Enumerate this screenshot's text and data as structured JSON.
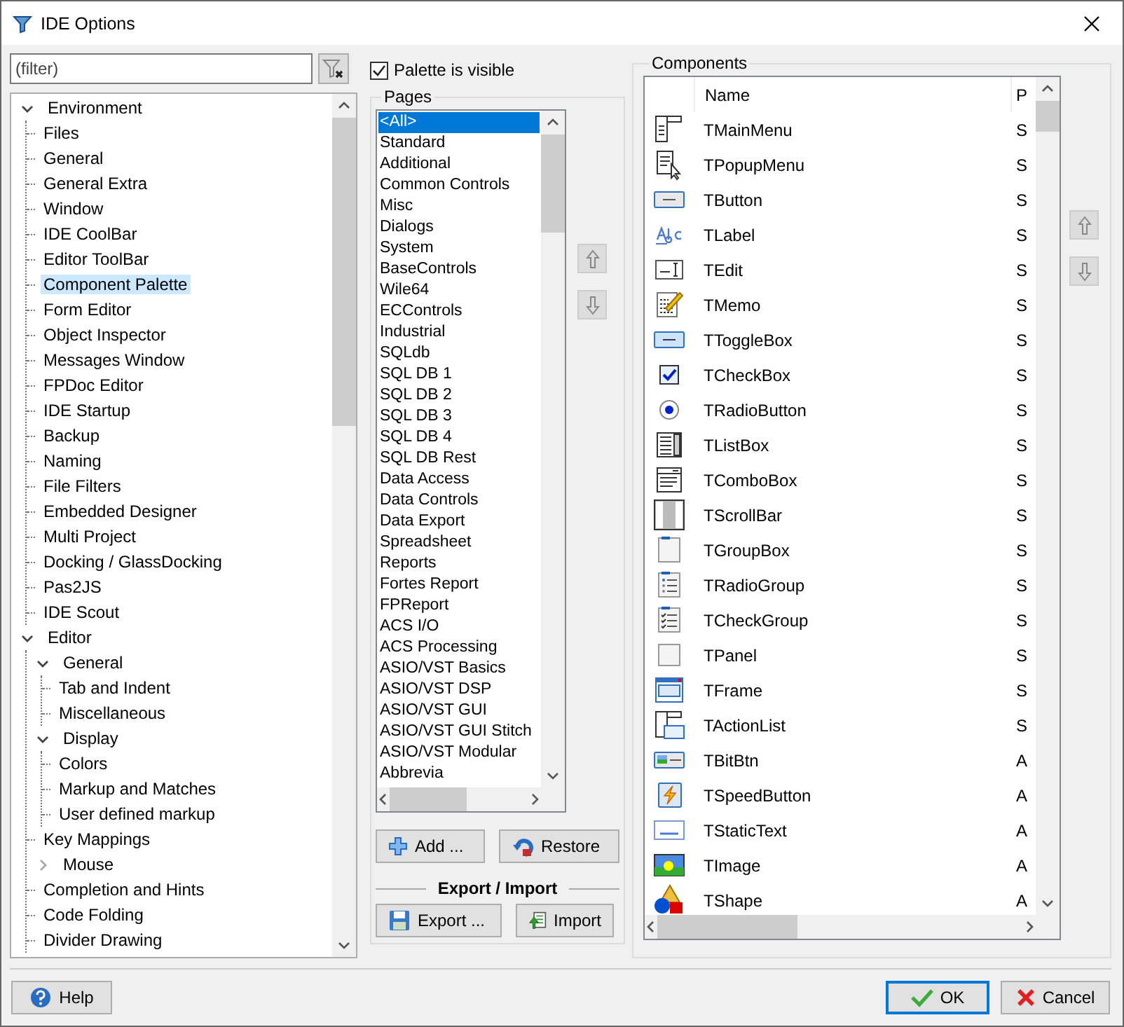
{
  "window": {
    "title": "IDE Options"
  },
  "filter": {
    "placeholder": "(filter)"
  },
  "tree": [
    {
      "label": "Environment",
      "expanded": true,
      "selected": false,
      "children": [
        {
          "label": "Files",
          "selected": false
        },
        {
          "label": "General",
          "selected": false
        },
        {
          "label": "General Extra",
          "selected": false
        },
        {
          "label": "Window",
          "selected": false
        },
        {
          "label": "IDE CoolBar",
          "selected": false
        },
        {
          "label": "Editor ToolBar",
          "selected": false
        },
        {
          "label": "Component Palette",
          "selected": true
        },
        {
          "label": "Form Editor",
          "selected": false
        },
        {
          "label": "Object Inspector",
          "selected": false
        },
        {
          "label": "Messages Window",
          "selected": false
        },
        {
          "label": "FPDoc Editor",
          "selected": false
        },
        {
          "label": "IDE Startup",
          "selected": false
        },
        {
          "label": "Backup",
          "selected": false
        },
        {
          "label": "Naming",
          "selected": false
        },
        {
          "label": "File Filters",
          "selected": false
        },
        {
          "label": "Embedded Designer",
          "selected": false
        },
        {
          "label": "Multi Project",
          "selected": false
        },
        {
          "label": "Docking / GlassDocking",
          "selected": false
        },
        {
          "label": "Pas2JS",
          "selected": false
        },
        {
          "label": "IDE Scout",
          "selected": false
        }
      ]
    },
    {
      "label": "Editor",
      "expanded": true,
      "selected": false,
      "children": [
        {
          "label": "General",
          "expanded": true,
          "selected": false,
          "children": [
            {
              "label": "Tab and Indent",
              "selected": false
            },
            {
              "label": "Miscellaneous",
              "selected": false
            }
          ]
        },
        {
          "label": "Display",
          "expanded": true,
          "selected": false,
          "children": [
            {
              "label": "Colors",
              "selected": false
            },
            {
              "label": "Markup and Matches",
              "selected": false
            },
            {
              "label": "User defined markup",
              "selected": false
            }
          ]
        },
        {
          "label": "Key Mappings",
          "selected": false
        },
        {
          "label": "Mouse",
          "expanded": false,
          "selected": false
        },
        {
          "label": "Completion and Hints",
          "selected": false
        },
        {
          "label": "Code Folding",
          "selected": false
        },
        {
          "label": "Divider Drawing",
          "selected": false
        }
      ]
    }
  ],
  "palette_visible": {
    "label": "Palette is visible",
    "checked": true
  },
  "pages": {
    "title": "Pages",
    "items": [
      {
        "label": "<All>",
        "selected": true
      },
      {
        "label": "Standard",
        "selected": false
      },
      {
        "label": "Additional",
        "selected": false
      },
      {
        "label": "Common Controls",
        "selected": false
      },
      {
        "label": "Misc",
        "selected": false
      },
      {
        "label": "Dialogs",
        "selected": false
      },
      {
        "label": "System",
        "selected": false
      },
      {
        "label": "BaseControls",
        "selected": false
      },
      {
        "label": "Wile64",
        "selected": false
      },
      {
        "label": "ECControls",
        "selected": false
      },
      {
        "label": "Industrial",
        "selected": false
      },
      {
        "label": "SQLdb",
        "selected": false
      },
      {
        "label": "SQL DB 1",
        "selected": false
      },
      {
        "label": "SQL DB 2",
        "selected": false
      },
      {
        "label": "SQL DB 3",
        "selected": false
      },
      {
        "label": "SQL DB 4",
        "selected": false
      },
      {
        "label": "SQL DB Rest",
        "selected": false
      },
      {
        "label": "Data Access",
        "selected": false
      },
      {
        "label": "Data Controls",
        "selected": false
      },
      {
        "label": "Data Export",
        "selected": false
      },
      {
        "label": "Spreadsheet",
        "selected": false
      },
      {
        "label": "Reports",
        "selected": false
      },
      {
        "label": "Fortes Report",
        "selected": false
      },
      {
        "label": "FPReport",
        "selected": false
      },
      {
        "label": "ACS I/O",
        "selected": false
      },
      {
        "label": "ACS Processing",
        "selected": false
      },
      {
        "label": "ASIO/VST Basics",
        "selected": false
      },
      {
        "label": "ASIO/VST DSP",
        "selected": false
      },
      {
        "label": "ASIO/VST GUI",
        "selected": false
      },
      {
        "label": "ASIO/VST GUI Stitch",
        "selected": false
      },
      {
        "label": "ASIO/VST Modular",
        "selected": false
      },
      {
        "label": "Abbrevia",
        "selected": false
      }
    ],
    "add_button": "Add ...",
    "restore_button": "Restore",
    "export_import_title": "Export / Import",
    "export_button": "Export ...",
    "import_button": "Import"
  },
  "components": {
    "title": "Components",
    "columns": [
      "Name",
      "P"
    ],
    "rows": [
      {
        "name": "TMainMenu",
        "column_2": "S"
      },
      {
        "name": "TPopupMenu",
        "column_2": "S"
      },
      {
        "name": "TButton",
        "column_2": "S"
      },
      {
        "name": "TLabel",
        "column_2": "S"
      },
      {
        "name": "TEdit",
        "column_2": "S"
      },
      {
        "name": "TMemo",
        "column_2": "S"
      },
      {
        "name": "TToggleBox",
        "column_2": "S"
      },
      {
        "name": "TCheckBox",
        "column_2": "S"
      },
      {
        "name": "TRadioButton",
        "column_2": "S"
      },
      {
        "name": "TListBox",
        "column_2": "S"
      },
      {
        "name": "TComboBox",
        "column_2": "S"
      },
      {
        "name": "TScrollBar",
        "column_2": "S"
      },
      {
        "name": "TGroupBox",
        "column_2": "S"
      },
      {
        "name": "TRadioGroup",
        "column_2": "S"
      },
      {
        "name": "TCheckGroup",
        "column_2": "S"
      },
      {
        "name": "TPanel",
        "column_2": "S"
      },
      {
        "name": "TFrame",
        "column_2": "S"
      },
      {
        "name": "TActionList",
        "column_2": "S"
      },
      {
        "name": "TBitBtn",
        "column_2": "A"
      },
      {
        "name": "TSpeedButton",
        "column_2": "A"
      },
      {
        "name": "TStaticText",
        "column_2": "A"
      },
      {
        "name": "TImage",
        "column_2": "A"
      },
      {
        "name": "TShape",
        "column_2": "A"
      }
    ]
  },
  "footer": {
    "help": "Help",
    "ok": "OK",
    "cancel": "Cancel"
  }
}
